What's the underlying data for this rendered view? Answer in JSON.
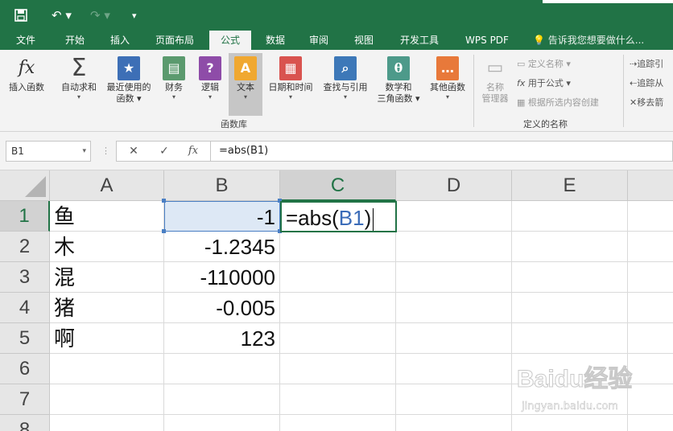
{
  "tabs": [
    "文件",
    "开始",
    "插入",
    "页面布局",
    "公式",
    "数据",
    "审阅",
    "视图",
    "开发工具",
    "WPS PDF"
  ],
  "active_tab": "公式",
  "tell_me": "告诉我您想要做什么...",
  "ribbon": {
    "insert_function": "插入函数",
    "autosum": "自动求和",
    "recent_1": "最近使用的",
    "recent_2": "函数",
    "financial": "财务",
    "logical": "逻辑",
    "text": "文本",
    "datetime": "日期和时间",
    "lookup": "查找与引用",
    "math_1": "数学和",
    "math_2": "三角函数",
    "other": "其他函数",
    "group_library": "函数库",
    "name_mgr_1": "名称",
    "name_mgr_2": "管理器",
    "define_name": "定义名称",
    "use_in_formula": "用于公式",
    "create_from_sel": "根据所选内容创建",
    "group_names": "定义的名称",
    "trace_prec": "追踪引",
    "trace_dep": "追踪从",
    "remove_arrows": "移去箭"
  },
  "formula_bar": {
    "name_box": "B1",
    "formula": "=abs(B1)"
  },
  "columns": [
    "A",
    "B",
    "C",
    "D",
    "E"
  ],
  "rows": [
    "1",
    "2",
    "3",
    "4",
    "5",
    "6",
    "7",
    "8"
  ],
  "cells": {
    "A": [
      "鱼",
      "木",
      "混",
      "猪",
      "啊"
    ],
    "B": [
      "-1",
      "-1.2345",
      "-110000",
      "-0.005",
      "123"
    ]
  },
  "editing_cell": {
    "prefix": "=abs(",
    "ref": "B1",
    "suffix": ")"
  },
  "watermark": {
    "main": "Baidu经验",
    "sub": "jingyan.baidu.com"
  },
  "colors": {
    "excel_green": "#217346",
    "ref_blue": "#3b6cb8",
    "ref_fill": "#dde8f5"
  }
}
